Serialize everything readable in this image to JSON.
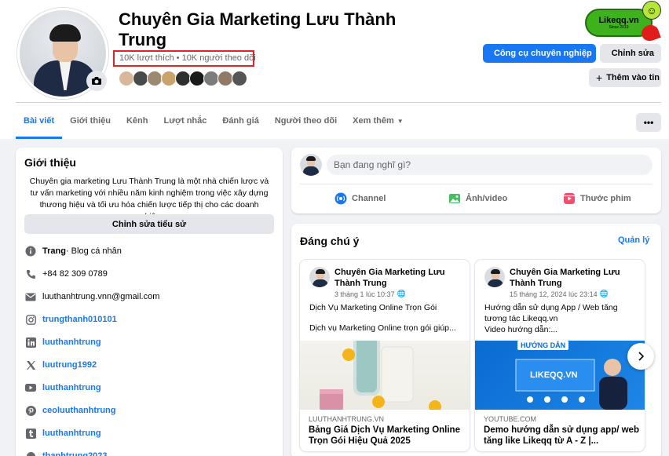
{
  "profile": {
    "name": "Chuyên Gia Marketing Lưu Thành Trung",
    "stats": "10K lượt thích • 10K người theo dõi"
  },
  "brand": {
    "logo_text": "Likeqq.vn",
    "logo_sub": "Since 2019"
  },
  "actions": {
    "tools": "Công cụ chuyên nghiệp",
    "edit": "Chỉnh sửa",
    "add_to_story": "Thêm vào tin"
  },
  "tabs": [
    {
      "label": "Bài viết"
    },
    {
      "label": "Giới thiệu"
    },
    {
      "label": "Kênh"
    },
    {
      "label": "Lượt nhắc"
    },
    {
      "label": "Đánh giá"
    },
    {
      "label": "Người theo dõi"
    },
    {
      "label": "Xem thêm"
    }
  ],
  "more_label": "•••",
  "intro": {
    "title": "Giới thiệu",
    "bio": "Chuyên gia marketing Lưu Thành Trung là một nhà chiến lược và tư vấn marketing với nhiều năm kinh nghiệm trong việc xây dựng thương hiệu và tối ưu hóa chiến lược tiếp thị cho các doanh nghiệp.",
    "edit_bio": "Chỉnh sửa tiểu sử",
    "page_type_bold": "Trang",
    "page_type_rest": " · Blog cá nhân",
    "phone": "+84 82 309 0789",
    "email": "luuthanhtrung.vnn@gmail.com",
    "instagram": "trungthanh010101",
    "linkedin": "luuthanhtrung",
    "x": "luutrung1992",
    "youtube": "luuthanhtrung",
    "pinterest": "ceoluuthanhtrung",
    "tumblr": "luuthanhtrung",
    "extra": "thanhtrung2023"
  },
  "composer": {
    "placeholder": "Bạn đang nghĩ gì?",
    "channel": "Channel",
    "photo": "Ảnh/video",
    "reel": "Thước phim"
  },
  "featured": {
    "title": "Đáng chú ý",
    "manage": "Quản lý",
    "cards": [
      {
        "author": "Chuyên Gia Marketing Lưu Thành Trung",
        "time": "3 tháng 1 lúc 10:37",
        "line1": "Dịch Vụ Marketing Online Trọn Gói",
        "line2": "Dịch vụ Marketing Online trọn gói giúp...",
        "domain": "LUUTHANHTRUNG.VN",
        "link_title": "Bảng Giá Dịch Vụ Marketing Online Trọn Gói Hiệu Quả 2025"
      },
      {
        "author": "Chuyên Gia Marketing Lưu Thành Trung",
        "time": "15 tháng 12, 2024 lúc 23:14",
        "line1": "Hướng dẫn sử dụng App / Web tăng tương tác Likeqq.vn",
        "line2": "Video hướng dẫn:...",
        "domain": "YOUTUBE.COM",
        "link_title": "Demo hướng dẫn sử dụng app/ web tăng like Likeqq từ A - Z |...",
        "image_heading": "HƯỚNG DẪN",
        "image_brand": "LIKEQQ.VN"
      }
    ]
  },
  "colors": {
    "accent": "#1877f2",
    "highlight_box": "#e0242b",
    "logo_green": "#3db21c"
  }
}
